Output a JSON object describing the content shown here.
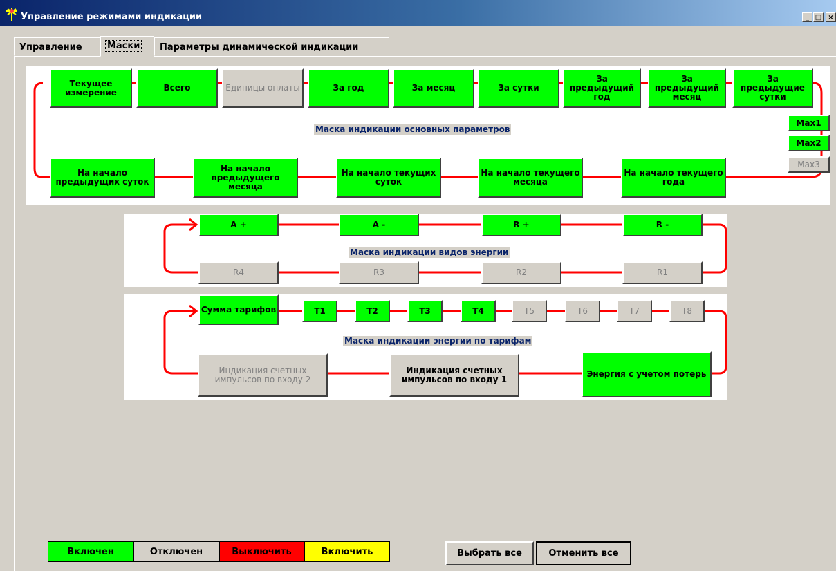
{
  "window": {
    "title": "Управление режимами индикации",
    "btn_min": "_",
    "btn_max": "□",
    "btn_close": "×"
  },
  "tabs": [
    "Управление",
    "Маски",
    "Параметры динамической индикации"
  ],
  "main_params": {
    "caption": "Маска индикации основных параметров",
    "top": [
      {
        "label": "Текущее измерение",
        "state": "on"
      },
      {
        "label": "Всего",
        "state": "on"
      },
      {
        "label": "Единицы оплаты",
        "state": "off"
      },
      {
        "label": "За год",
        "state": "on"
      },
      {
        "label": "За месяц",
        "state": "on"
      },
      {
        "label": "За сутки",
        "state": "on"
      },
      {
        "label": "За предыдущий год",
        "state": "on"
      },
      {
        "label": "За предыдущий месяц",
        "state": "on"
      },
      {
        "label": "За предыдущие сутки",
        "state": "on"
      }
    ],
    "max": [
      {
        "label": "Max1",
        "state": "on"
      },
      {
        "label": "Max2",
        "state": "on"
      },
      {
        "label": "Max3",
        "state": "off"
      }
    ],
    "bottom": [
      {
        "label": "На начало предыдущих суток",
        "state": "on"
      },
      {
        "label": "На начало предыдущего месяца",
        "state": "on"
      },
      {
        "label": "На начало текущих суток",
        "state": "on"
      },
      {
        "label": "На начало текущего месяца",
        "state": "on"
      },
      {
        "label": "На начало текущего года",
        "state": "on"
      }
    ]
  },
  "energy_types": {
    "caption": "Маска индикации видов энергии",
    "top": [
      {
        "label": "A +",
        "state": "on"
      },
      {
        "label": "A -",
        "state": "on"
      },
      {
        "label": "R +",
        "state": "on"
      },
      {
        "label": "R -",
        "state": "on"
      }
    ],
    "bottom": [
      {
        "label": "R4",
        "state": "off"
      },
      {
        "label": "R3",
        "state": "off"
      },
      {
        "label": "R2",
        "state": "off"
      },
      {
        "label": "R1",
        "state": "off"
      }
    ]
  },
  "tariffs": {
    "caption": "Маска индикации энергии по тарифам",
    "sum": {
      "label": "Сумма тарифов",
      "state": "on"
    },
    "t": [
      {
        "label": "T1",
        "state": "on"
      },
      {
        "label": "T2",
        "state": "on"
      },
      {
        "label": "T3",
        "state": "on"
      },
      {
        "label": "T4",
        "state": "on"
      },
      {
        "label": "T5",
        "state": "off"
      },
      {
        "label": "T6",
        "state": "off"
      },
      {
        "label": "T7",
        "state": "off"
      },
      {
        "label": "T8",
        "state": "off"
      }
    ],
    "bottom": [
      {
        "label": "Индикация счетных импульсов по входу 2",
        "state": "off"
      },
      {
        "label": "Индикация счетных импульсов по входу 1",
        "state": "offb"
      },
      {
        "label": "Энергия с учетом потерь",
        "state": "on"
      }
    ]
  },
  "legend": [
    {
      "label": "Включен",
      "bg": "#00ff00",
      "fg": "#000000"
    },
    {
      "label": "Отключен",
      "bg": "#d4d0c8",
      "fg": "#000000"
    },
    {
      "label": "Выключить",
      "bg": "#ff0000",
      "fg": "#000000"
    },
    {
      "label": "Включить",
      "bg": "#ffff00",
      "fg": "#000000"
    }
  ],
  "buttons": {
    "select_all": "Выбрать все",
    "cancel_all": "Отменить все"
  },
  "colors": {
    "on": "#00ff00",
    "off": "#d4d0c8",
    "line": "#ff0000",
    "caption": "#0a246a"
  }
}
